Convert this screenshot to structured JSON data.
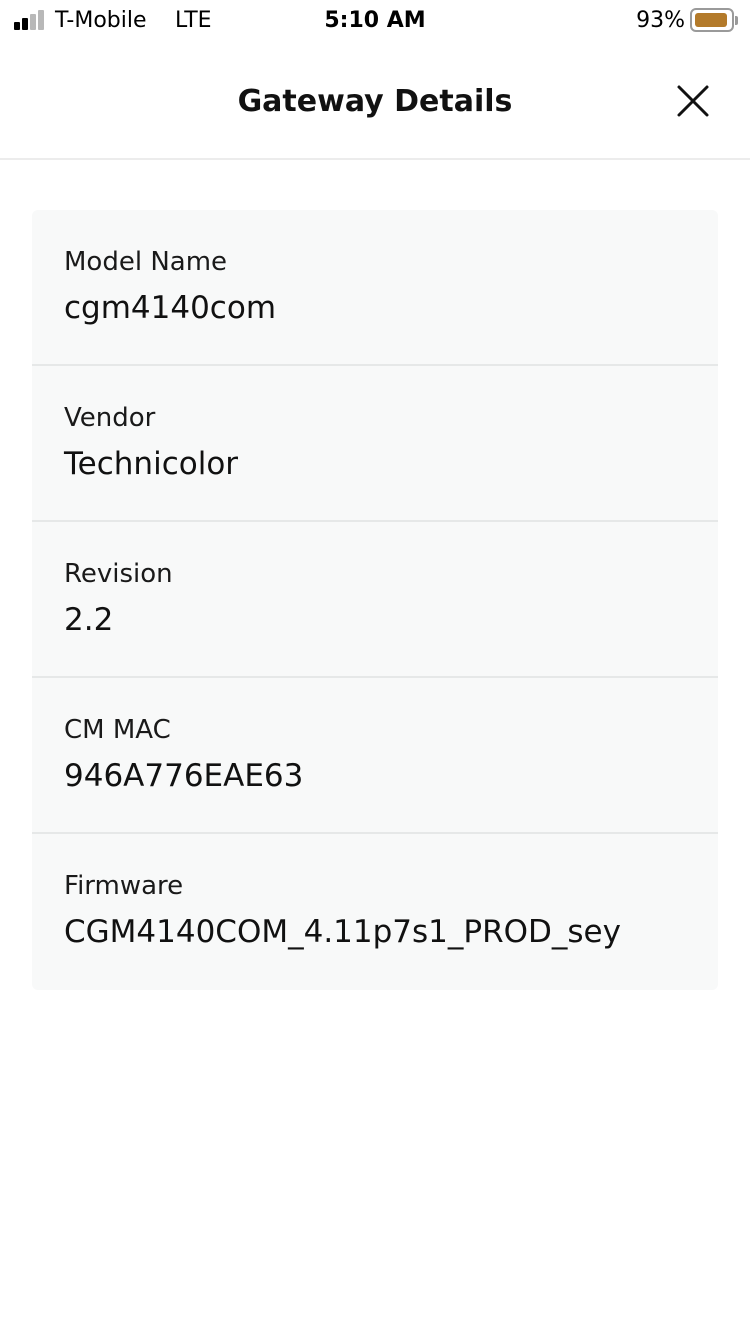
{
  "status_bar": {
    "carrier": "T-Mobile",
    "network": "LTE",
    "time": "5:10 AM",
    "battery_percent": "93%",
    "battery_level": 0.93,
    "battery_color": "#b37a2a",
    "signal_bars_filled": 2
  },
  "header": {
    "title": "Gateway Details",
    "close_icon": "close-icon"
  },
  "details": [
    {
      "label": "Model Name",
      "value": "cgm4140com"
    },
    {
      "label": "Vendor",
      "value": "Technicolor"
    },
    {
      "label": "Revision",
      "value": "2.2"
    },
    {
      "label": "CM MAC",
      "value": "946A776EAE63"
    },
    {
      "label": "Firmware",
      "value": "CGM4140COM_4.11p7s1_PROD_sey"
    }
  ]
}
